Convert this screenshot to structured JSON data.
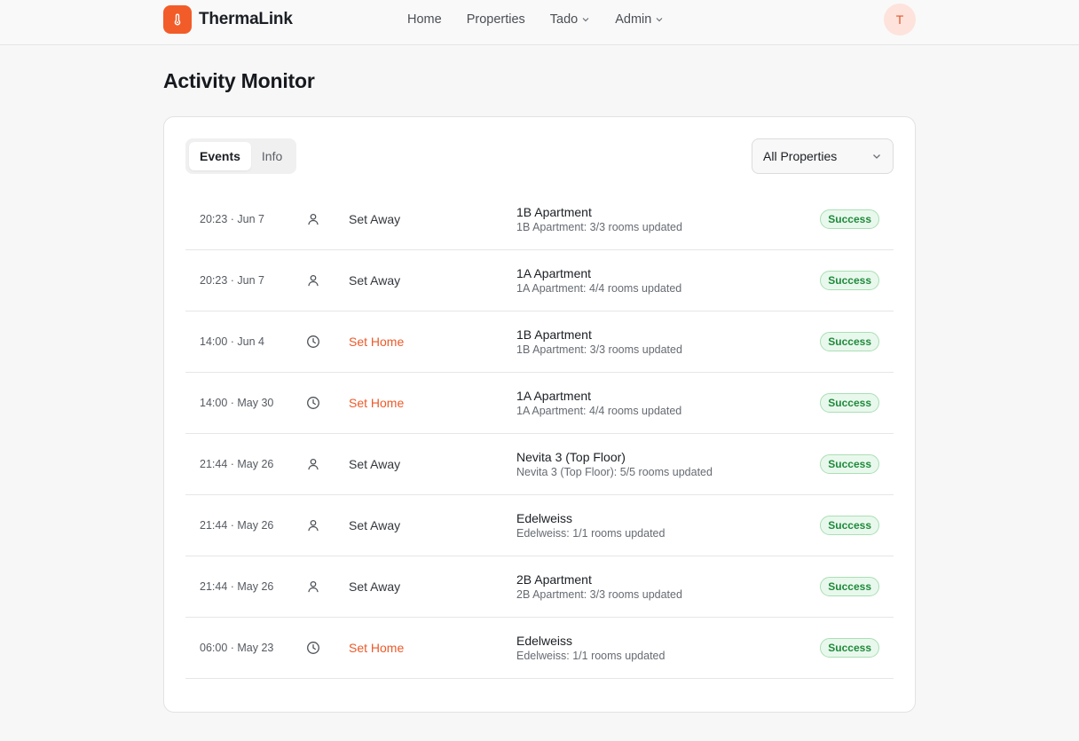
{
  "brand": {
    "name": "ThermaLink",
    "color": "#f25c29"
  },
  "nav": {
    "links": [
      {
        "label": "Home",
        "dropdown": false
      },
      {
        "label": "Properties",
        "dropdown": false
      },
      {
        "label": "Tado",
        "dropdown": true
      },
      {
        "label": "Admin",
        "dropdown": true
      }
    ],
    "avatar_initial": "T"
  },
  "page": {
    "title": "Activity Monitor"
  },
  "tabs": [
    {
      "label": "Events",
      "active": true
    },
    {
      "label": "Info",
      "active": false
    }
  ],
  "filter": {
    "selected": "All Properties"
  },
  "events": [
    {
      "time": "20:23 · Jun 7",
      "icon": "user-icon",
      "action": "Set Away",
      "type": "away",
      "property": "1B Apartment",
      "detail": "1B Apartment: 3/3 rooms updated",
      "status": "Success"
    },
    {
      "time": "20:23 · Jun 7",
      "icon": "user-icon",
      "action": "Set Away",
      "type": "away",
      "property": "1A Apartment",
      "detail": "1A Apartment: 4/4 rooms updated",
      "status": "Success"
    },
    {
      "time": "14:00 · Jun 4",
      "icon": "clock-icon",
      "action": "Set Home",
      "type": "home",
      "property": "1B Apartment",
      "detail": "1B Apartment: 3/3 rooms updated",
      "status": "Success"
    },
    {
      "time": "14:00 · May 30",
      "icon": "clock-icon",
      "action": "Set Home",
      "type": "home",
      "property": "1A Apartment",
      "detail": "1A Apartment: 4/4 rooms updated",
      "status": "Success"
    },
    {
      "time": "21:44 · May 26",
      "icon": "user-icon",
      "action": "Set Away",
      "type": "away",
      "property": "Nevita 3 (Top Floor)",
      "detail": "Nevita 3 (Top Floor): 5/5 rooms updated",
      "status": "Success"
    },
    {
      "time": "21:44 · May 26",
      "icon": "user-icon",
      "action": "Set Away",
      "type": "away",
      "property": "Edelweiss",
      "detail": "Edelweiss: 1/1 rooms updated",
      "status": "Success"
    },
    {
      "time": "21:44 · May 26",
      "icon": "user-icon",
      "action": "Set Away",
      "type": "away",
      "property": "2B Apartment",
      "detail": "2B Apartment: 3/3 rooms updated",
      "status": "Success"
    },
    {
      "time": "06:00 · May 23",
      "icon": "clock-icon",
      "action": "Set Home",
      "type": "home",
      "property": "Edelweiss",
      "detail": "Edelweiss: 1/1 rooms updated",
      "status": "Success"
    }
  ],
  "colors": {
    "accent": "#ec5a2a",
    "success_text": "#1e8a3c",
    "success_bg": "#e9f8ec"
  }
}
